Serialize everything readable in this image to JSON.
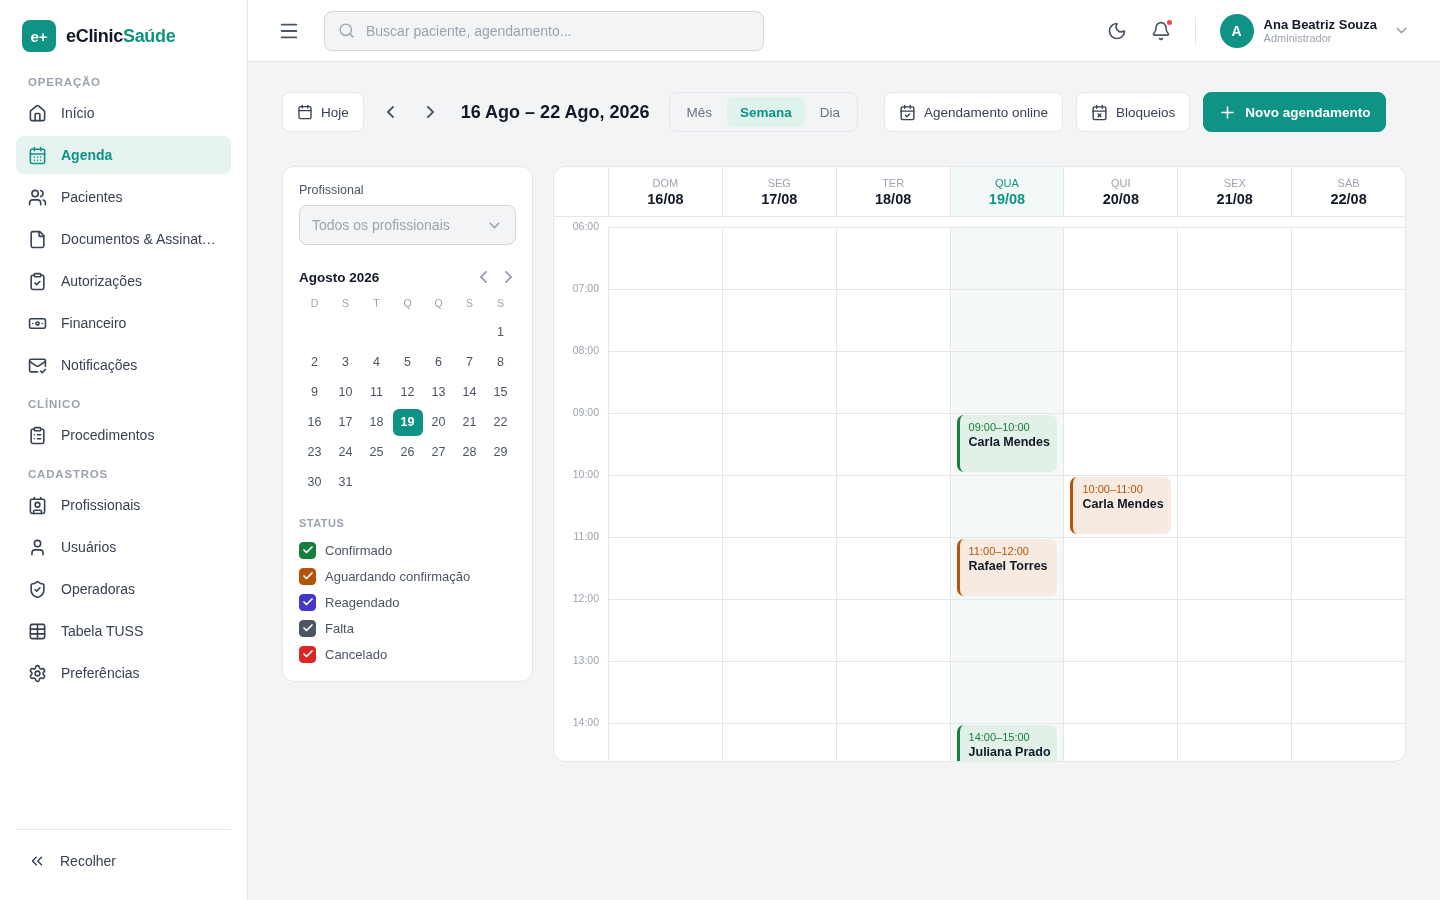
{
  "brand": {
    "mark": "e+",
    "name": "eClinic",
    "accent": "Saúde"
  },
  "sidebar": {
    "sections": [
      {
        "title": "OPERAÇÃO",
        "items": [
          {
            "label": "Início",
            "selected": false
          },
          {
            "label": "Agenda",
            "selected": true
          },
          {
            "label": "Pacientes",
            "selected": false
          },
          {
            "label": "Documentos & Assinat…",
            "selected": false
          },
          {
            "label": "Autorizações",
            "selected": false
          },
          {
            "label": "Financeiro",
            "selected": false
          },
          {
            "label": "Notificações",
            "selected": false
          }
        ]
      },
      {
        "title": "CLÍNICO",
        "items": [
          {
            "label": "Procedimentos",
            "selected": false
          }
        ]
      },
      {
        "title": "CADASTROS",
        "items": [
          {
            "label": "Profissionais",
            "selected": false
          },
          {
            "label": "Usuários",
            "selected": false
          },
          {
            "label": "Operadoras",
            "selected": false
          },
          {
            "label": "Tabela TUSS",
            "selected": false
          },
          {
            "label": "Preferências",
            "selected": false
          }
        ]
      }
    ],
    "collapse": "Recolher"
  },
  "topbar": {
    "search": {
      "placeholder": "Buscar paciente, agendamento..."
    },
    "notification_dot": true,
    "user": {
      "initial": "A",
      "name": "Ana Beatriz Souza",
      "role": "Administrador"
    }
  },
  "toolbar": {
    "today": "Hoje",
    "range": "16 Ago – 22 Ago, 2026",
    "views": [
      {
        "label": "Mês",
        "selected": false
      },
      {
        "label": "Semana",
        "selected": true
      },
      {
        "label": "Dia",
        "selected": false
      }
    ],
    "online": "Agendamento online",
    "blocks": "Bloqueios",
    "new": "Novo agendamento"
  },
  "filters": {
    "professional_label": "Profissional",
    "professional_placeholder": "Todos os profissionais",
    "month": "Agosto 2026",
    "weekdays": [
      "D",
      "S",
      "T",
      "Q",
      "Q",
      "S",
      "S"
    ],
    "weeks": [
      {
        "days": [
          {
            "label": "1",
            "selected": false
          }
        ]
      },
      {
        "days": [
          {
            "label": "2",
            "selected": false
          },
          {
            "label": "3",
            "selected": false
          },
          {
            "label": "4",
            "selected": false
          },
          {
            "label": "5",
            "selected": false
          },
          {
            "label": "6",
            "selected": false
          },
          {
            "label": "7",
            "selected": false
          },
          {
            "label": "8",
            "selected": false
          }
        ]
      },
      {
        "days": [
          {
            "label": "9",
            "selected": false
          },
          {
            "label": "10",
            "selected": false
          },
          {
            "label": "11",
            "selected": false
          },
          {
            "label": "12",
            "selected": false
          },
          {
            "label": "13",
            "selected": false
          },
          {
            "label": "14",
            "selected": false
          },
          {
            "label": "15",
            "selected": false
          }
        ]
      },
      {
        "days": [
          {
            "label": "16",
            "selected": false
          },
          {
            "label": "17",
            "selected": false
          },
          {
            "label": "18",
            "selected": false
          },
          {
            "label": "19",
            "selected": true
          },
          {
            "label": "20",
            "selected": false
          },
          {
            "label": "21",
            "selected": false
          },
          {
            "label": "22",
            "selected": false
          }
        ]
      },
      {
        "days": [
          {
            "label": "23",
            "selected": false
          },
          {
            "label": "24",
            "selected": false
          },
          {
            "label": "25",
            "selected": false
          },
          {
            "label": "26",
            "selected": false
          },
          {
            "label": "27",
            "selected": false
          },
          {
            "label": "28",
            "selected": false
          },
          {
            "label": "29",
            "selected": false
          }
        ]
      },
      {
        "days": [
          {
            "label": "30",
            "selected": false
          },
          {
            "label": "31",
            "selected": false
          }
        ]
      }
    ],
    "status_title": "STATUS",
    "statuses": [
      {
        "label": "Confirmado",
        "checked": true,
        "color": "#15803d"
      },
      {
        "label": "Aguardando confirmação",
        "checked": true,
        "color": "#b45309"
      },
      {
        "label": "Reagendado",
        "checked": true,
        "color": "#4338ca"
      },
      {
        "label": "Falta",
        "checked": true,
        "color": "#4b5563"
      },
      {
        "label": "Cancelado",
        "checked": true,
        "color": "#dc2626"
      }
    ]
  },
  "calendar": {
    "hours": [
      "06:00",
      "07:00",
      "08:00",
      "09:00",
      "10:00",
      "11:00",
      "12:00",
      "13:00",
      "14:00"
    ],
    "days": [
      {
        "weekday": "DOM",
        "date": "16/08",
        "selected": false
      },
      {
        "weekday": "SEG",
        "date": "17/08",
        "selected": false
      },
      {
        "weekday": "TER",
        "date": "18/08",
        "selected": false
      },
      {
        "weekday": "QUA",
        "date": "19/08",
        "selected": true,
        "events": [
          {
            "time": "09:00–10:00",
            "patient": "Carla Mendes",
            "color": "#15803d"
          },
          {
            "time": "11:00–12:00",
            "patient": "Rafael Torres",
            "color": "#b45309"
          },
          {
            "time": "14:00–15:00",
            "patient": "Juliana Prado",
            "color": "#15803d"
          }
        ]
      },
      {
        "weekday": "QUI",
        "date": "20/08",
        "selected": false,
        "events": [
          {
            "time": "10:00–11:00",
            "patient": "Carla Mendes",
            "color": "#b45309"
          }
        ]
      },
      {
        "weekday": "SEX",
        "date": "21/08",
        "selected": false
      },
      {
        "weekday": "SÁB",
        "date": "22/08",
        "selected": false
      }
    ]
  }
}
